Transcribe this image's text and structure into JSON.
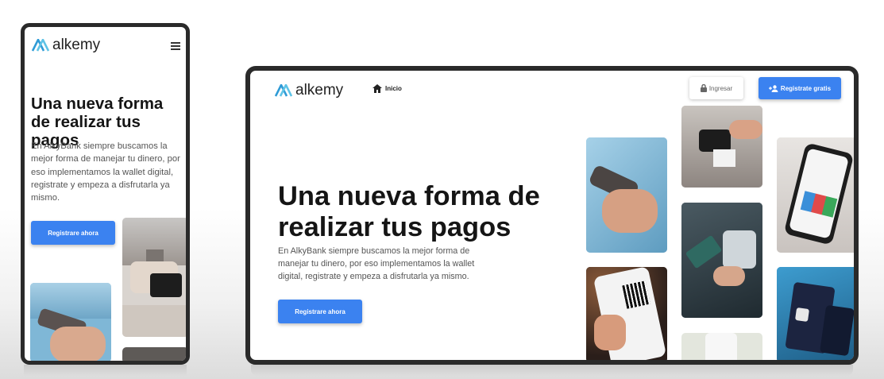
{
  "brand": {
    "name": "alkemy",
    "accent": "#3b82f0",
    "logo_color": "#2f9bd6"
  },
  "phone": {
    "menu_icon": "hamburger-icon",
    "headline": "Una nueva forma de realizar tus pagos",
    "description": "En AlkyBank siempre buscamos la mejor forma de manejar tu dinero, por eso implementamos la wallet digital, registrate y empeza a disfrutarla ya mismo.",
    "cta_label": "Registrare ahora"
  },
  "tablet": {
    "nav_home_icon": "home-icon",
    "nav_home_label": "Inicio",
    "login_icon": "lock-icon",
    "login_label": "Ingresar",
    "register_icon": "add-user-icon",
    "register_label": "Registrate gratis",
    "headline": "Una nueva forma de realizar tus pagos",
    "description": "En AlkyBank siempre buscamos la mejor forma de manejar tu dinero, por eso implementamos la wallet digital, registrate y empeza a disfrutarla ya mismo.",
    "cta_label": "Registrare ahora"
  }
}
